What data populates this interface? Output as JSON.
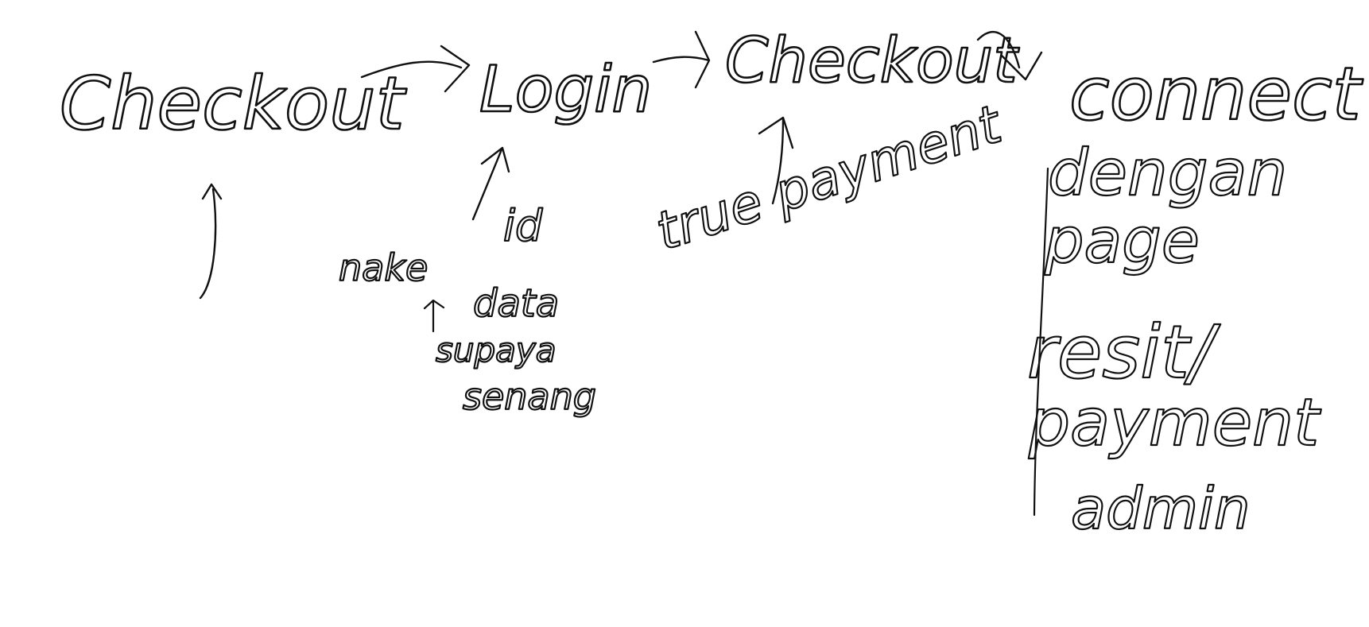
{
  "colors": {
    "background": "#ffffff",
    "ink": "#111111"
  },
  "flow": {
    "step1": "Checkout",
    "step2": "Login",
    "step3": "Checkout",
    "step4": "connect"
  },
  "notes": {
    "arrow_label_under_checkout": "",
    "login_note_1": "id",
    "login_note_2": "nake",
    "login_note_3": "data",
    "login_note_4": "supaya",
    "login_note_5": "senang",
    "payment_label": "true payment",
    "connect_note_1": "dengan",
    "connect_note_2": "page",
    "connect_note_3": "resit/",
    "connect_note_4": "payment",
    "connect_note_5": "admin"
  }
}
